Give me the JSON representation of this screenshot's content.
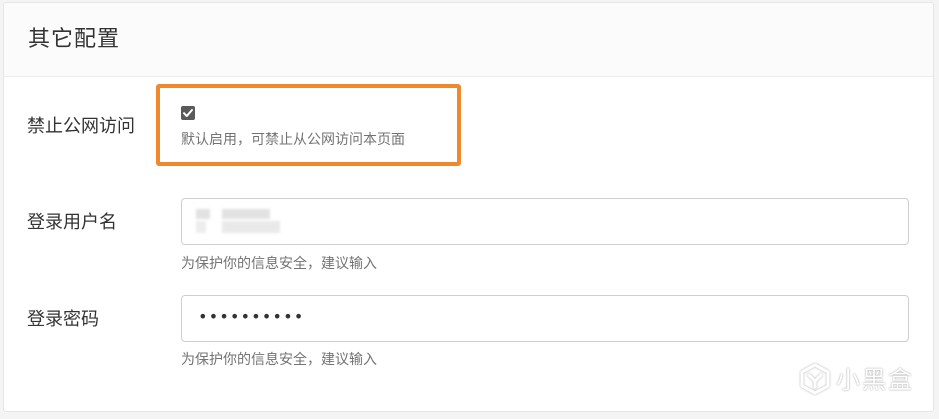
{
  "panel": {
    "title": "其它配置"
  },
  "public_access": {
    "label": "禁止公网访问",
    "checked": true,
    "help": "默认启用，可禁止从公网访问本页面"
  },
  "username": {
    "label": "登录用户名",
    "value": "",
    "help": "为保护你的信息安全，建议输入"
  },
  "password": {
    "label": "登录密码",
    "value_masked": "••••••••••",
    "help": "为保护你的信息安全，建议输入"
  },
  "watermark": {
    "text": "小黑盒"
  },
  "colors": {
    "highlight": "#f0892d",
    "checkbox": "#5a5a5a"
  }
}
